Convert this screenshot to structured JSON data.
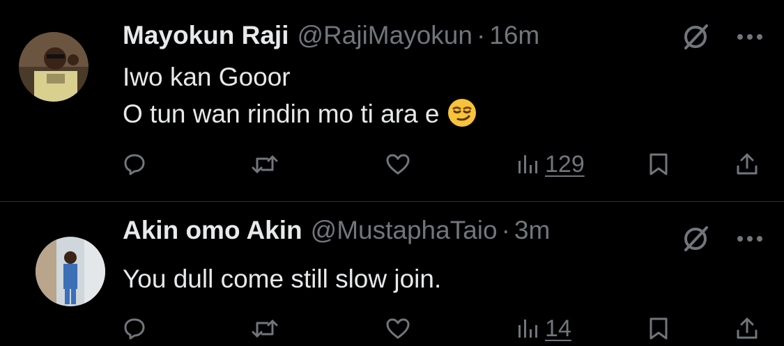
{
  "tweets": [
    {
      "display_name": "Mayokun Raji",
      "handle": "@RajiMayokun",
      "separator": "·",
      "time": "16m",
      "text_lines": [
        "Iwo kan Gooor",
        "O tun wan rindin mo ti ara e"
      ],
      "emoji": "smirking-face",
      "views": "129"
    },
    {
      "display_name": "Akin omo Akin",
      "handle": "@MustaphaTaio",
      "separator": "·",
      "time": "3m",
      "text_lines": [
        "You dull come still slow join."
      ],
      "views": "14"
    }
  ],
  "icons": {
    "mute": "mute-icon",
    "more": "more-icon",
    "reply": "reply-icon",
    "retweet": "retweet-icon",
    "like": "heart-icon",
    "views": "views-icon",
    "bookmark": "bookmark-icon",
    "share": "share-icon"
  },
  "colors": {
    "background": "#000000",
    "primary_text": "#e7e9ea",
    "secondary_text": "#71767b",
    "divider": "#2f3336"
  }
}
